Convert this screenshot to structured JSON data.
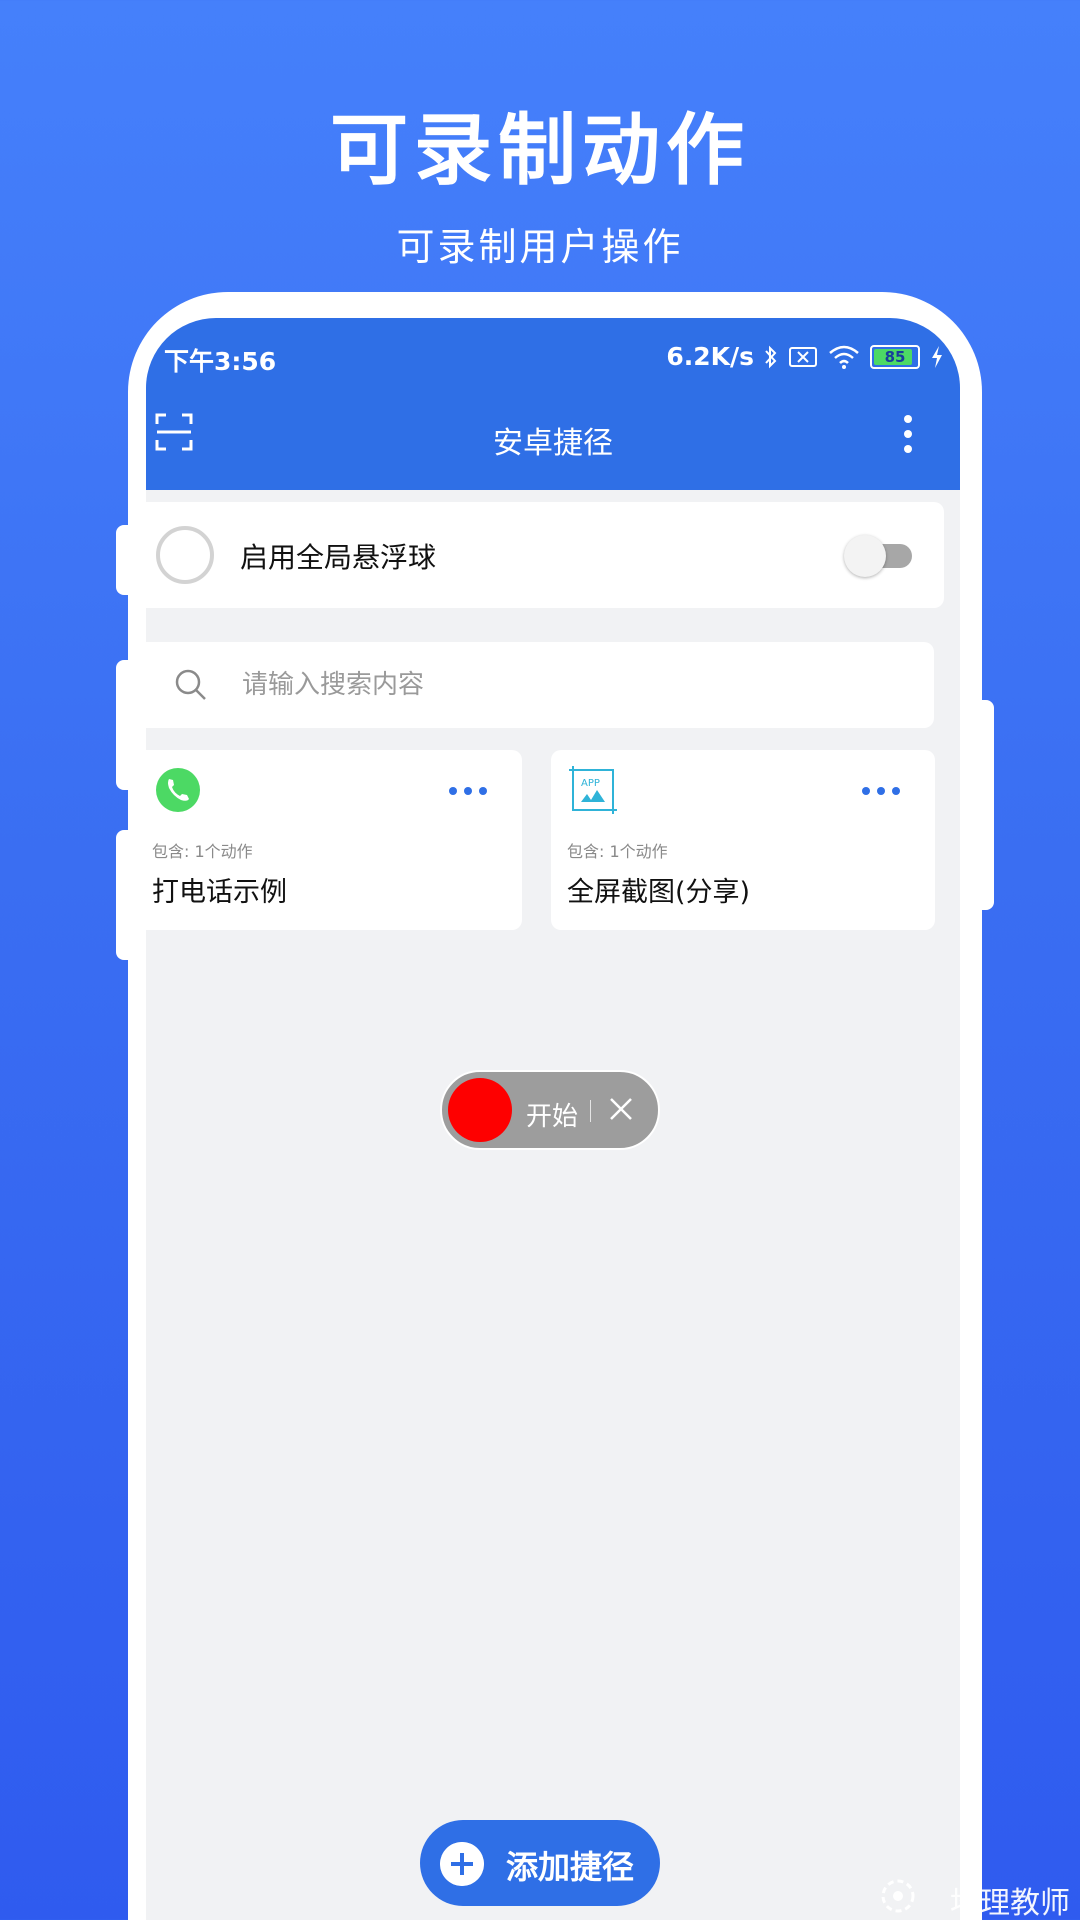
{
  "hero": {
    "title": "可录制动作",
    "subtitle": "可录制用户操作"
  },
  "status_bar": {
    "time": "下午3:56",
    "net_speed": "6.2K/s",
    "battery": "85"
  },
  "toolbar": {
    "title": "安卓捷径"
  },
  "floating_ball": {
    "label": "启用全局悬浮球",
    "enabled": false
  },
  "search": {
    "placeholder": "请输入搜索内容",
    "value": ""
  },
  "shortcuts": [
    {
      "name": "打电话示例",
      "count_label": "包含: 1个动作",
      "icon": "phone-icon"
    },
    {
      "name": "全屏截图(分享)",
      "count_label": "包含: 1个动作",
      "icon": "app-screenshot-icon"
    }
  ],
  "recorder": {
    "start_label": "开始"
  },
  "fab": {
    "label": "添加捷径"
  },
  "watermark": {
    "text": "地理教师"
  },
  "colors": {
    "primary": "#2f6fe6",
    "background_gradient_top": "#4580fb",
    "record_red": "#fe0000",
    "phone_green": "#4cd964"
  }
}
